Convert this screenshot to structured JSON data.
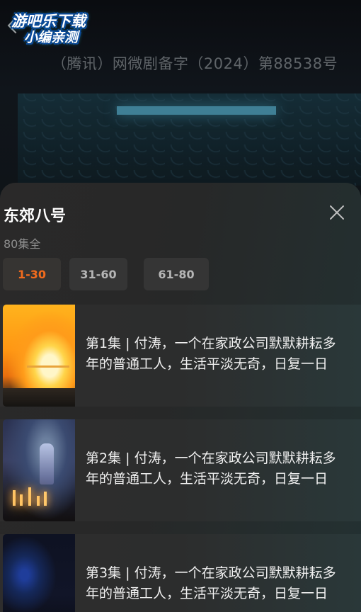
{
  "player": {
    "license_text": "（腾讯）网微剧备字（2024）第88538号"
  },
  "watermark": {
    "line1": "游吧乐下载",
    "line2": "小编亲测"
  },
  "sheet": {
    "title": "东郊八号",
    "subtitle": "80集全",
    "ranges": [
      {
        "label": "1-30",
        "active": true
      },
      {
        "label": "31-60",
        "active": false
      },
      {
        "label": "61-80",
        "active": false
      }
    ],
    "accent_color": "#f26b1d",
    "episodes": [
      {
        "text": "第1集 | 付涛，一个在家政公司默默耕耘多年的普通工人，生活平淡无奇，日复一日"
      },
      {
        "text": "第2集 | 付涛，一个在家政公司默默耕耘多年的普通工人，生活平淡无奇，日复一日"
      },
      {
        "text": "第3集 | 付涛，一个在家政公司默默耕耘多年的普通工人，生活平淡无奇，日复一日"
      }
    ]
  }
}
